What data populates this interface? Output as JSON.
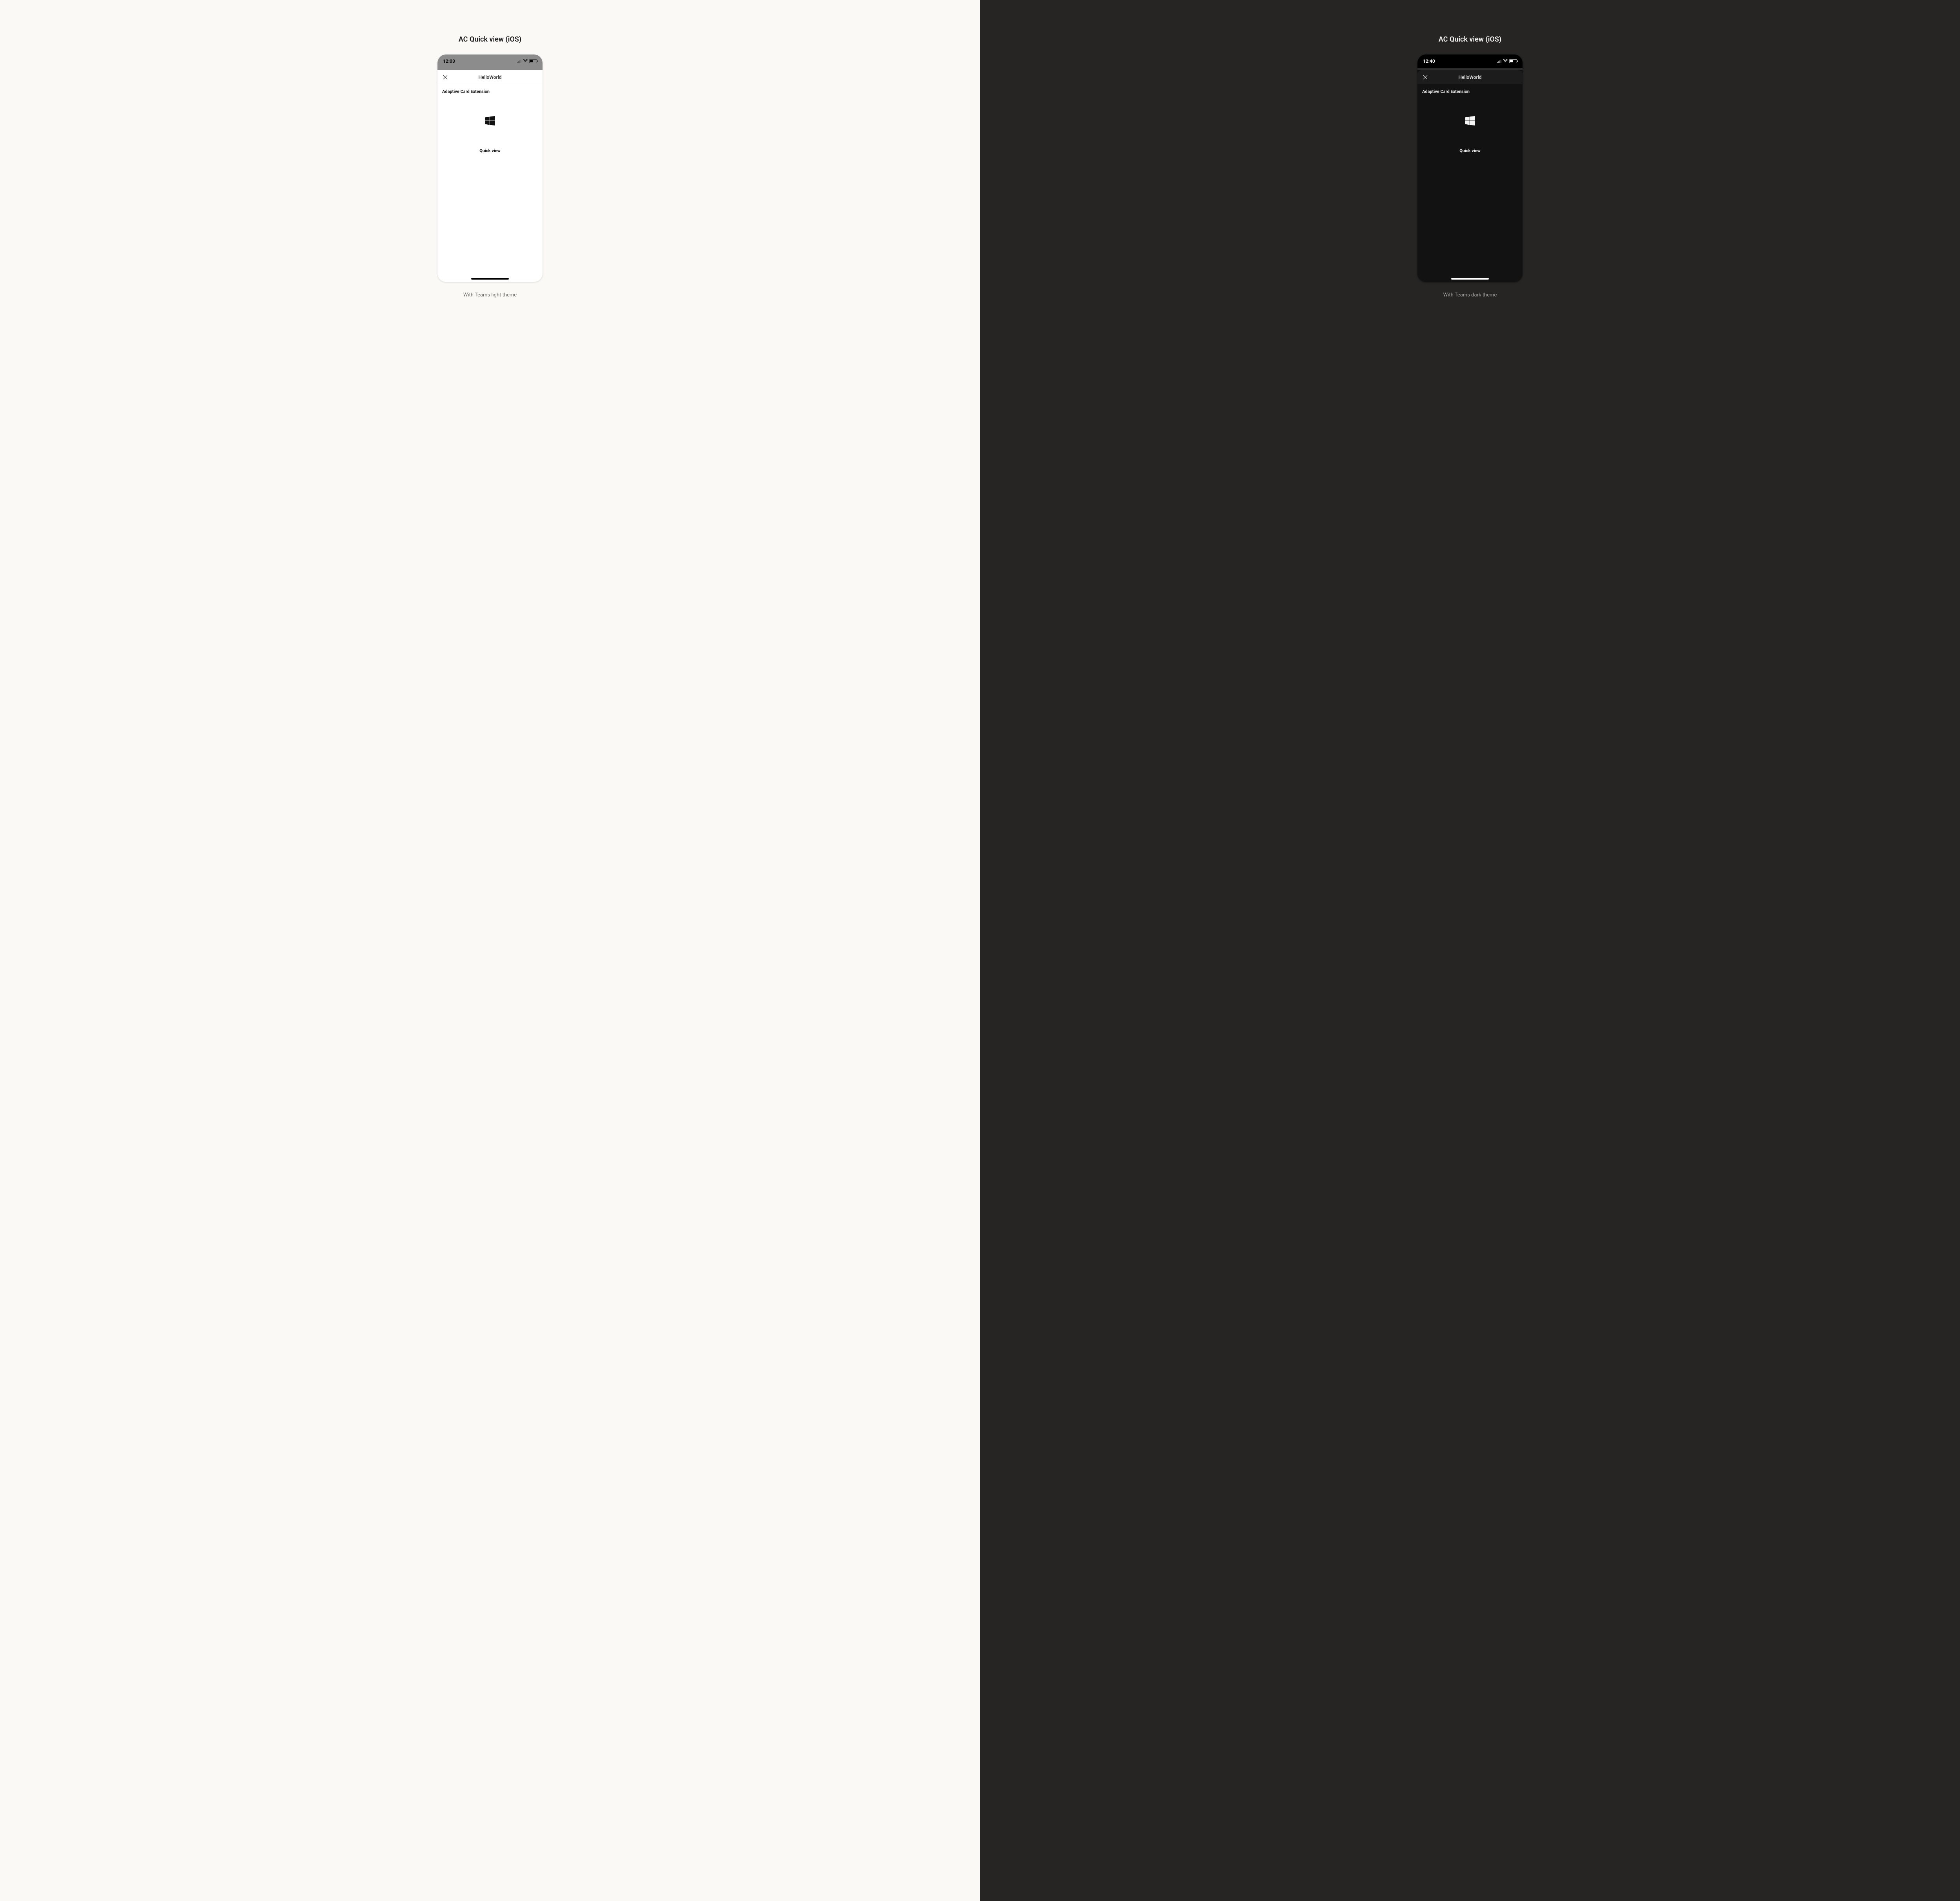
{
  "light": {
    "panel_title": "AC Quick view (iOS)",
    "status_time": "12:03",
    "sheet_title": "HelloWorld",
    "section_label": "Adaptive Card Extension",
    "quickview_label": "Quick view",
    "caption": "With Teams light theme"
  },
  "dark": {
    "panel_title": "AC Quick view (iOS)",
    "status_time": "12:40",
    "sheet_title": "HelloWorld",
    "section_label": "Adaptive Card Extension",
    "quickview_label": "Quick view",
    "caption": "With Teams dark theme"
  }
}
